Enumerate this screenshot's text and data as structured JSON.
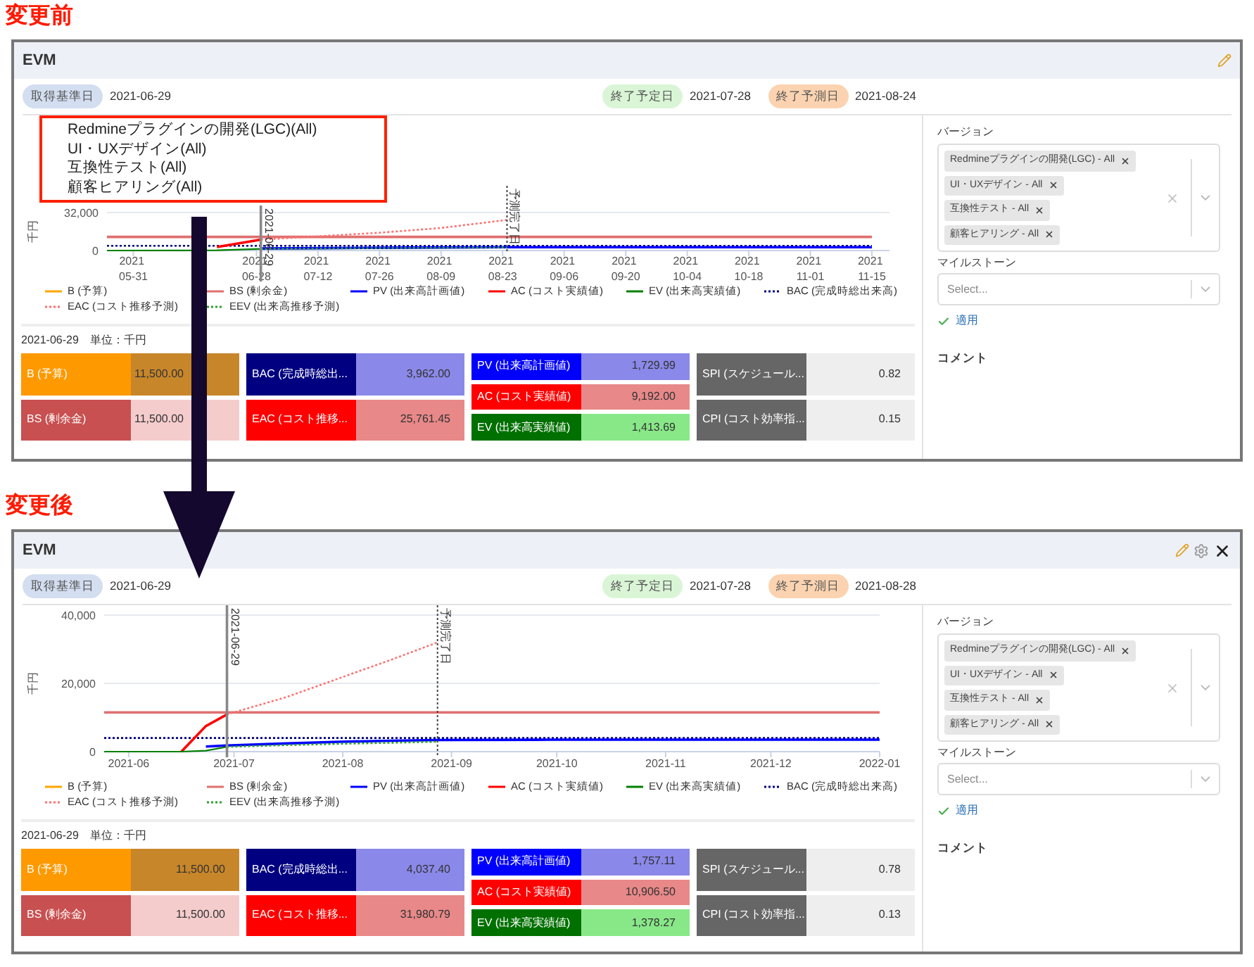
{
  "sections": [
    {
      "heading": "変更前",
      "panel": {
        "title": "EVM",
        "settings_button": false,
        "close_button": false,
        "dates": [
          {
            "kind": "basis",
            "label": "取得基準日",
            "value": "2021-06-29"
          },
          {
            "kind": "planned",
            "label": "終了予定日",
            "value": "2021-07-28"
          },
          {
            "kind": "forecast",
            "label": "終了予測日",
            "value": "2021-08-24"
          }
        ],
        "callout": {
          "lines": [
            "Redmineプラグインの開発(LGC)(All)",
            "UI・UXデザイン(All)",
            "互換性テスト(All)",
            "顧客ヒアリング(All)"
          ]
        },
        "chart_data": {
          "type": "line",
          "ylabel": "千円",
          "x": [
            "2021-05-25",
            "2021-06-19",
            "2021-06-29",
            "2021-07-12",
            "2021-07-26",
            "2021-08-09",
            "2021-08-24",
            "2021-09-06",
            "2021-09-20",
            "2021-10-04",
            "2021-10-18",
            "2021-11-01",
            "2021-11-15"
          ],
          "xticks": [
            {
              "value": "2021-05-31",
              "label": "2021 05-31"
            },
            {
              "value": "2021-06-28",
              "label": "2021 06-28"
            },
            {
              "value": "2021-07-12",
              "label": "2021 07-12"
            },
            {
              "value": "2021-07-26",
              "label": "2021 07-26"
            },
            {
              "value": "2021-08-09",
              "label": "2021 08-09"
            },
            {
              "value": "2021-08-23",
              "label": "2021 08-23"
            },
            {
              "value": "2021-09-06",
              "label": "2021 09-06"
            },
            {
              "value": "2021-09-20",
              "label": "2021 09-20"
            },
            {
              "value": "2021-10-04",
              "label": "2021 10-04"
            },
            {
              "value": "2021-10-18",
              "label": "2021 10-18"
            },
            {
              "value": "2021-11-01",
              "label": "2021 11-01"
            },
            {
              "value": "2021-11-15",
              "label": "2021 11-15"
            }
          ],
          "xlim": [
            "2021-05-25",
            "2021-11-19"
          ],
          "ylim": [
            0,
            32000
          ],
          "yticks": [
            {
              "value": 0,
              "label": "0"
            },
            {
              "value": 32000,
              "label": "32,000"
            }
          ],
          "series": [
            {
              "name": "B (予算)",
              "color": "#ffa500",
              "line_style": "solid",
              "values": [
                null,
                null,
                null,
                null,
                null,
                null,
                null,
                null,
                null,
                null,
                null,
                null,
                null
              ]
            },
            {
              "name": "BS (剰余金)",
              "color": "#e07070",
              "line_style": "solid",
              "values": [
                11500,
                11500,
                11500,
                11500,
                11500,
                11500,
                11500,
                11500,
                11500,
                11500,
                11500,
                11500,
                11500
              ]
            },
            {
              "name": "PV (出来高計画値)",
              "color": "#0000ff",
              "line_style": "solid",
              "values": [
                null,
                null,
                1700,
                2000,
                2300,
                2600,
                2800,
                2800,
                2800,
                2800,
                2800,
                2800,
                2800
              ]
            },
            {
              "name": "AC (コスト実績値)",
              "color": "#ff0000",
              "line_style": "solid",
              "values": [
                null,
                3000,
                9200,
                null,
                null,
                null,
                null,
                null,
                null,
                null,
                null,
                null,
                null
              ]
            },
            {
              "name": "EV (出来高実績値)",
              "color": "#008000",
              "line_style": "solid",
              "values": [
                0,
                200,
                1400,
                null,
                null,
                null,
                null,
                null,
                null,
                null,
                null,
                null,
                null
              ]
            },
            {
              "name": "BAC (完成時総出来高)",
              "color": "#000080",
              "line_style": "dotted",
              "values": [
                3962,
                3962,
                3962,
                3962,
                3962,
                3962,
                3962,
                3962,
                3962,
                3962,
                3962,
                3962,
                3962
              ]
            },
            {
              "name": "EAC (コスト推移予測)",
              "color": "#ff7070",
              "line_style": "dotted",
              "values": [
                null,
                null,
                9200,
                12000,
                15000,
                19000,
                25800,
                null,
                null,
                null,
                null,
                null,
                null
              ]
            },
            {
              "name": "EEV (出来高推移予測)",
              "color": "#30a030",
              "line_style": "dotted",
              "values": [
                null,
                null,
                1400,
                1700,
                2000,
                2300,
                2600,
                null,
                null,
                null,
                null,
                null,
                null
              ]
            }
          ],
          "ref_lines": [
            {
              "axis": "x",
              "value": "2021-06-29",
              "label": "2021-06-29",
              "line_style": "solid"
            },
            {
              "axis": "x",
              "value": "2021-08-24",
              "label": "予測完了日",
              "line_style": "dotted"
            }
          ]
        },
        "summary": {
          "date": "2021-06-29",
          "unit": "単位：千円",
          "groups": [
            [
              {
                "label": "B (予算)",
                "color": "#ff9900",
                "value": {
                  "text": "11,500.00",
                  "color": "#c8862a"
                }
              },
              {
                "label": "BS (剰余金)",
                "color": "#c85050",
                "value": {
                  "text": "11,500.00",
                  "color": "#f5cccc"
                }
              }
            ],
            [
              {
                "label": "BAC (完成時総出...",
                "color": "#000080",
                "value": {
                  "text": "3,962.00",
                  "color": "#8a88e8"
                }
              },
              {
                "label": "EAC (コスト推移...",
                "color": "#ff0000",
                "value": {
                  "text": "25,761.45",
                  "color": "#e88888"
                }
              }
            ],
            [
              {
                "label": "PV (出来高計画値)",
                "color": "#0000ff",
                "value": {
                  "text": "1,729.99",
                  "color": "#8a88e8"
                }
              },
              {
                "label": "AC (コスト実績値)",
                "color": "#ff0000",
                "value": {
                  "text": "9,192.00",
                  "color": "#e88888"
                }
              },
              {
                "label": "EV (出来高実績値)",
                "color": "#007000",
                "value": {
                  "text": "1,413.69",
                  "color": "#88e888"
                }
              }
            ],
            [
              {
                "label": "SPI (スケジュール...",
                "color": "#666666",
                "value": {
                  "text": "0.82",
                  "color": "#eeeeee"
                }
              },
              {
                "label": "CPI (コスト効率指...",
                "color": "#666666",
                "value": {
                  "text": "0.15",
                  "color": "#eeeeee"
                }
              }
            ]
          ]
        },
        "sidebar": {
          "version_label": "バージョン",
          "versions": [
            "Redmineプラグインの開発(LGC) - All",
            "UI・UXデザイン - All",
            "互換性テスト - All",
            "顧客ヒアリング - All"
          ],
          "milestone_label": "マイルストーン",
          "milestone_placeholder": "Select...",
          "apply": "適用",
          "comment_label": "コメント"
        }
      }
    },
    {
      "heading": "変更後",
      "panel": {
        "title": "EVM",
        "settings_button": true,
        "close_button": true,
        "dates": [
          {
            "kind": "basis",
            "label": "取得基準日",
            "value": "2021-06-29"
          },
          {
            "kind": "planned",
            "label": "終了予定日",
            "value": "2021-07-28"
          },
          {
            "kind": "forecast",
            "label": "終了予測日",
            "value": "2021-08-28"
          }
        ],
        "chart_data": {
          "type": "line",
          "ylabel": "千円",
          "x": [
            "2021-05-25",
            "2021-06-16",
            "2021-06-23",
            "2021-06-29",
            "2021-07-16",
            "2021-07-31",
            "2021-08-15",
            "2021-08-28",
            "2021-09-29",
            "2021-10-29",
            "2021-12-01",
            "2022-01-01"
          ],
          "xticks": [
            {
              "value": "2021-06-01",
              "label": "2021-06"
            },
            {
              "value": "2021-07-01",
              "label": "2021-07"
            },
            {
              "value": "2021-08-01",
              "label": "2021-08"
            },
            {
              "value": "2021-09-01",
              "label": "2021-09"
            },
            {
              "value": "2021-10-01",
              "label": "2021-10"
            },
            {
              "value": "2021-11-01",
              "label": "2021-11"
            },
            {
              "value": "2021-12-01",
              "label": "2021-12"
            },
            {
              "value": "2022-01-01",
              "label": "2022-01"
            }
          ],
          "xlim": [
            "2021-05-25",
            "2022-01-01"
          ],
          "ylim": [
            0,
            40000
          ],
          "yticks": [
            {
              "value": 0,
              "label": "0"
            },
            {
              "value": 20000,
              "label": "20,000"
            },
            {
              "value": 40000,
              "label": "40,000"
            }
          ],
          "series": [
            {
              "name": "B (予算)",
              "color": "#ffa500",
              "line_style": "solid",
              "values": [
                null,
                null,
                null,
                null,
                null,
                null,
                null,
                null,
                null,
                null,
                null,
                null
              ]
            },
            {
              "name": "BS (剰余金)",
              "color": "#e07070",
              "line_style": "solid",
              "values": [
                11500,
                11500,
                11500,
                11500,
                11500,
                11500,
                11500,
                11500,
                11500,
                11500,
                11500,
                11500
              ]
            },
            {
              "name": "PV (出来高計画値)",
              "color": "#0000ff",
              "line_style": "solid",
              "values": [
                null,
                null,
                1500,
                1800,
                2400,
                2900,
                3200,
                3400,
                3500,
                3500,
                3500,
                3500
              ]
            },
            {
              "name": "AC (コスト実績値)",
              "color": "#ff0000",
              "line_style": "solid",
              "values": [
                null,
                0,
                7500,
                10900,
                null,
                null,
                null,
                null,
                null,
                null,
                null,
                null
              ]
            },
            {
              "name": "EV (出来高実績値)",
              "color": "#008000",
              "line_style": "solid",
              "values": [
                0,
                0,
                300,
                1400,
                null,
                null,
                null,
                null,
                null,
                null,
                null,
                null
              ]
            },
            {
              "name": "BAC (完成時総出来高)",
              "color": "#000080",
              "line_style": "dotted",
              "values": [
                4000,
                4000,
                4000,
                4000,
                4000,
                4000,
                4000,
                4000,
                4000,
                4000,
                4000,
                4000
              ]
            },
            {
              "name": "EAC (コスト推移予測)",
              "color": "#ff7070",
              "line_style": "dotted",
              "values": [
                null,
                null,
                null,
                10900,
                16000,
                21500,
                27000,
                32000,
                null,
                null,
                null,
                null
              ]
            },
            {
              "name": "EEV (出来高推移予測)",
              "color": "#30a030",
              "line_style": "dotted",
              "values": [
                null,
                null,
                null,
                1400,
                1900,
                2300,
                2600,
                2900,
                null,
                null,
                null,
                null
              ]
            }
          ],
          "ref_lines": [
            {
              "axis": "x",
              "value": "2021-06-29",
              "label": "2021-06-29",
              "line_style": "solid"
            },
            {
              "axis": "x",
              "value": "2021-08-28",
              "label": "予測完了日",
              "line_style": "dotted"
            }
          ]
        },
        "summary": {
          "date": "2021-06-29",
          "unit": "単位：千円",
          "groups": [
            [
              {
                "label": "B (予算)",
                "color": "#ff9900",
                "value": {
                  "text": "11,500.00",
                  "color": "#c8862a"
                }
              },
              {
                "label": "BS (剰余金)",
                "color": "#c85050",
                "value": {
                  "text": "11,500.00",
                  "color": "#f5cccc"
                }
              }
            ],
            [
              {
                "label": "BAC (完成時総出...",
                "color": "#000080",
                "value": {
                  "text": "4,037.40",
                  "color": "#8a88e8"
                }
              },
              {
                "label": "EAC (コスト推移...",
                "color": "#ff0000",
                "value": {
                  "text": "31,980.79",
                  "color": "#e88888"
                }
              }
            ],
            [
              {
                "label": "PV (出来高計画値)",
                "color": "#0000ff",
                "value": {
                  "text": "1,757.11",
                  "color": "#8a88e8"
                }
              },
              {
                "label": "AC (コスト実績値)",
                "color": "#ff0000",
                "value": {
                  "text": "10,906.50",
                  "color": "#e88888"
                }
              },
              {
                "label": "EV (出来高実績値)",
                "color": "#007000",
                "value": {
                  "text": "1,378.27",
                  "color": "#88e888"
                }
              }
            ],
            [
              {
                "label": "SPI (スケジュール...",
                "color": "#666666",
                "value": {
                  "text": "0.78",
                  "color": "#eeeeee"
                }
              },
              {
                "label": "CPI (コスト効率指...",
                "color": "#666666",
                "value": {
                  "text": "0.13",
                  "color": "#eeeeee"
                }
              }
            ]
          ]
        },
        "sidebar": {
          "version_label": "バージョン",
          "versions": [
            "Redmineプラグインの開発(LGC) - All",
            "UI・UXデザイン - All",
            "互換性テスト - All",
            "顧客ヒアリング - All"
          ],
          "milestone_label": "マイルストーン",
          "milestone_placeholder": "Select...",
          "apply": "適用",
          "comment_label": "コメント"
        }
      }
    }
  ]
}
